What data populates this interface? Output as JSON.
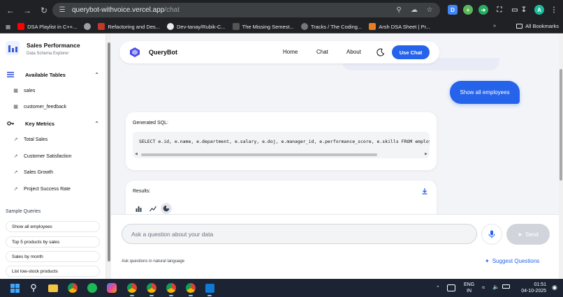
{
  "browser": {
    "url_host": "querybot-withvoice.vercel.app",
    "url_path": "/chat",
    "extensions": [
      "D",
      "A"
    ],
    "bookmarks": [
      {
        "label": "DSA Playlist in C++...",
        "color": "#ff0000"
      },
      {
        "label": "",
        "color": "#9aa0a6"
      },
      {
        "label": "Refactoring and Des...",
        "color": "#c0392b"
      },
      {
        "label": "Dev-tanay/Rubik-C...",
        "color": "#e8eaed"
      },
      {
        "label": "The Missing Semest...",
        "color": "#555555"
      },
      {
        "label": "Tracks / The Coding...",
        "color": "#777777"
      },
      {
        "label": "Arsh DSA Sheet | Pr...",
        "color": "#e67e22"
      }
    ],
    "all_bookmarks": "All Bookmarks"
  },
  "sidebar": {
    "title": "Sales Performance",
    "subtitle": "Data Schema Explorer",
    "tables_header": "Available Tables",
    "tables": [
      "sales",
      "customer_feedback"
    ],
    "metrics_header": "Key Metrics",
    "metrics": [
      "Total Sales",
      "Customer Satisfaction",
      "Sales Growth",
      "Project Success Rate"
    ],
    "samples_header": "Sample Queries",
    "samples": [
      "Show all employees",
      "Top 5 products by sales",
      "Sales by month",
      "List low-stock products"
    ]
  },
  "nav": {
    "brand": "QueryBot",
    "links": [
      "Home",
      "Chat",
      "About"
    ],
    "cta": "Use Chat"
  },
  "chat": {
    "user_message": "Show all employees",
    "sql_label": "Generated SQL:",
    "sql": "SELECT e.id, e.name, e.department, e.salary, e.doj, e.manager_id, e.performance_score, e.skills FROM employees e",
    "results_label": "Results:"
  },
  "composer": {
    "placeholder": "Ask a question about your data",
    "send_label": "Send",
    "hint": "Ask questions in natural language",
    "suggest_label": "Suggest Questions"
  },
  "taskbar": {
    "lang_line1": "ENG",
    "lang_line2": "IN",
    "time": "01:51",
    "date": "04-10-2025"
  }
}
